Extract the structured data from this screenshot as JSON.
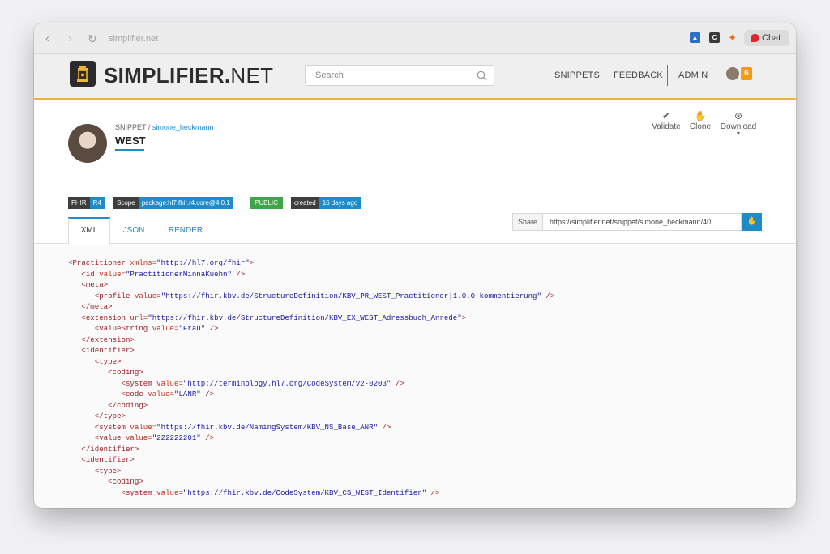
{
  "browser": {
    "url": "simplifier.net",
    "chat_label": "Chat",
    "ext_c_label": "C"
  },
  "site": {
    "brand_bold": "SIMPLIFIER.",
    "brand_light": "NET",
    "search_placeholder": "Search",
    "nav": {
      "snippets": "SNIPPETS",
      "feedback": "FEEDBACK",
      "admin": "ADMIN"
    },
    "notification_count": "6"
  },
  "snippet": {
    "breadcrumb_prefix": "SNIPPET / ",
    "author": "simone_heckmann",
    "title": "WEST",
    "actions": {
      "validate": "Validate",
      "clone": "Clone",
      "download": "Download"
    },
    "tags": {
      "fhir_key": "FHIR",
      "fhir_value": "R4",
      "scope_key": "Scope",
      "scope_value": "package:hl7.fhir.r4.core@4.0.1",
      "visibility": "PUBLIC",
      "created_key": "created",
      "created_value": "16 days ago"
    },
    "share": {
      "label": "Share",
      "url": "https://simplifier.net/snippet/simone_heckmann/40"
    },
    "tabs": [
      "XML",
      "JSON",
      "RENDER"
    ]
  },
  "code": {
    "lines": [
      {
        "indent": "",
        "parts": [
          {
            "t": "tg",
            "v": "<Practitioner "
          },
          {
            "t": "at",
            "v": "xmlns="
          },
          {
            "t": "vl",
            "v": "\"http://hl7.org/fhir\""
          },
          {
            "t": "tg",
            "v": ">"
          }
        ]
      },
      {
        "indent": "   ",
        "parts": [
          {
            "t": "tg",
            "v": "<id "
          },
          {
            "t": "at",
            "v": "value="
          },
          {
            "t": "vl",
            "v": "\"PractitionerMinnaKuehn\""
          },
          {
            "t": "tg",
            "v": " />"
          }
        ]
      },
      {
        "indent": "   ",
        "parts": [
          {
            "t": "tg",
            "v": "<meta>"
          }
        ]
      },
      {
        "indent": "      ",
        "parts": [
          {
            "t": "tg",
            "v": "<profile "
          },
          {
            "t": "at",
            "v": "value="
          },
          {
            "t": "vl",
            "v": "\"https://fhir.kbv.de/StructureDefinition/KBV_PR_WEST_Practitioner|1.0.0-kommentierung\""
          },
          {
            "t": "tg",
            "v": " />"
          }
        ]
      },
      {
        "indent": "   ",
        "parts": [
          {
            "t": "tg",
            "v": "</meta>"
          }
        ]
      },
      {
        "indent": "   ",
        "parts": [
          {
            "t": "tg",
            "v": "<extension "
          },
          {
            "t": "at",
            "v": "url="
          },
          {
            "t": "vl",
            "v": "\"https://fhir.kbv.de/StructureDefinition/KBV_EX_WEST_Adressbuch_Anrede\""
          },
          {
            "t": "tg",
            "v": ">"
          }
        ]
      },
      {
        "indent": "      ",
        "parts": [
          {
            "t": "tg",
            "v": "<valueString "
          },
          {
            "t": "at",
            "v": "value="
          },
          {
            "t": "vl",
            "v": "\"Frau\""
          },
          {
            "t": "tg",
            "v": " />"
          }
        ]
      },
      {
        "indent": "   ",
        "parts": [
          {
            "t": "tg",
            "v": "</extension>"
          }
        ]
      },
      {
        "indent": "   ",
        "parts": [
          {
            "t": "tg",
            "v": "<identifier>"
          }
        ]
      },
      {
        "indent": "      ",
        "parts": [
          {
            "t": "tg",
            "v": "<type>"
          }
        ]
      },
      {
        "indent": "         ",
        "parts": [
          {
            "t": "tg",
            "v": "<coding>"
          }
        ]
      },
      {
        "indent": "            ",
        "parts": [
          {
            "t": "tg",
            "v": "<system "
          },
          {
            "t": "at",
            "v": "value="
          },
          {
            "t": "vl",
            "v": "\"http://terminology.hl7.org/CodeSystem/v2-0203\""
          },
          {
            "t": "tg",
            "v": " />"
          }
        ]
      },
      {
        "indent": "            ",
        "parts": [
          {
            "t": "tg",
            "v": "<code "
          },
          {
            "t": "at",
            "v": "value="
          },
          {
            "t": "vl",
            "v": "\"LANR\""
          },
          {
            "t": "tg",
            "v": " />"
          }
        ]
      },
      {
        "indent": "         ",
        "parts": [
          {
            "t": "tg",
            "v": "</coding>"
          }
        ]
      },
      {
        "indent": "      ",
        "parts": [
          {
            "t": "tg",
            "v": "</type>"
          }
        ]
      },
      {
        "indent": "      ",
        "parts": [
          {
            "t": "tg",
            "v": "<system "
          },
          {
            "t": "at",
            "v": "value="
          },
          {
            "t": "vl",
            "v": "\"https://fhir.kbv.de/NamingSystem/KBV_NS_Base_ANR\""
          },
          {
            "t": "tg",
            "v": " />"
          }
        ]
      },
      {
        "indent": "      ",
        "parts": [
          {
            "t": "tg",
            "v": "<value "
          },
          {
            "t": "at",
            "v": "value="
          },
          {
            "t": "vl",
            "v": "\"222222201\""
          },
          {
            "t": "tg",
            "v": " />"
          }
        ]
      },
      {
        "indent": "   ",
        "parts": [
          {
            "t": "tg",
            "v": "</identifier>"
          }
        ]
      },
      {
        "indent": "   ",
        "parts": [
          {
            "t": "tg",
            "v": "<identifier>"
          }
        ]
      },
      {
        "indent": "      ",
        "parts": [
          {
            "t": "tg",
            "v": "<type>"
          }
        ]
      },
      {
        "indent": "         ",
        "parts": [
          {
            "t": "tg",
            "v": "<coding>"
          }
        ]
      },
      {
        "indent": "            ",
        "parts": [
          {
            "t": "tg",
            "v": "<system "
          },
          {
            "t": "at",
            "v": "value="
          },
          {
            "t": "vl",
            "v": "\"https://fhir.kbv.de/CodeSystem/KBV_CS_WEST_Identifier\""
          },
          {
            "t": "tg",
            "v": " />"
          }
        ]
      }
    ]
  }
}
